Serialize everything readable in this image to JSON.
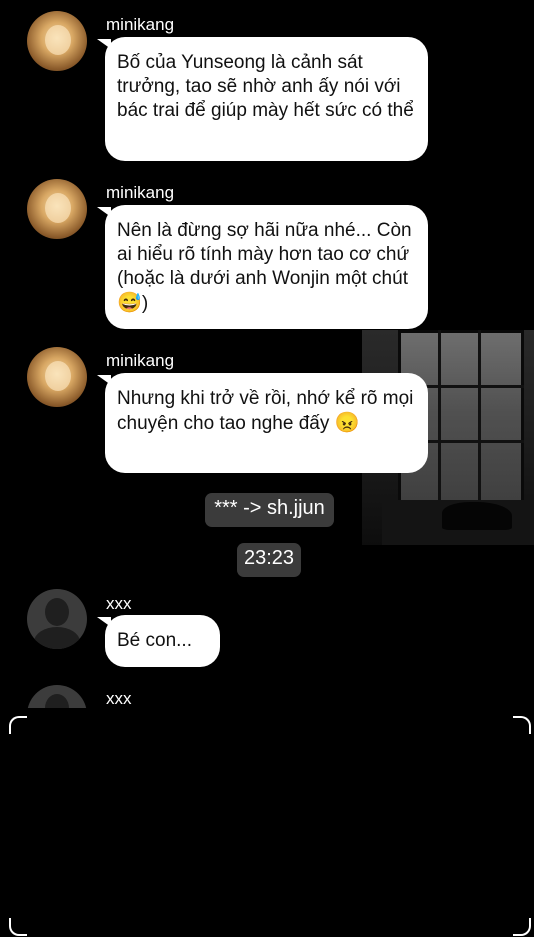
{
  "messages": [
    {
      "sender": "minikang",
      "text": " Bố của Yunseong là cảnh sát trưởng, tao sẽ nhờ anh ấy nói với bác trai để giúp mày hết sức có thể"
    },
    {
      "sender": "minikang",
      "text": " Nên là đừng sợ hãi nữa nhé... Còn ai hiểu rõ tính mày hơn tao cơ chứ (hoặc là dưới anh Wonjin một chút ",
      "emoji": "😅",
      "tail": ")"
    },
    {
      "sender": "minikang",
      "text": " Nhưng khi trở về rồi, nhớ kể rõ mọi chuyện cho tao nghe đấy ",
      "emoji": "😠"
    },
    {
      "sender": "xxx",
      "text": "Bé con..."
    },
    {
      "sender": "xxx"
    }
  ],
  "system": {
    "rename_notice": "*** -> sh.jjun",
    "timestamp": "23:23"
  },
  "icons": {
    "avatar_1": "profile-photo",
    "avatar_default": "default-user-silhouette"
  }
}
